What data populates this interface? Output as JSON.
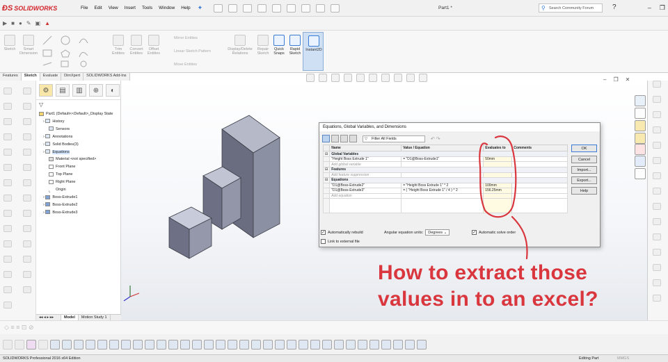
{
  "app": {
    "brand": "SOLIDWORKS",
    "document_title": "Part1 *",
    "search_placeholder": "Search Community Forum",
    "menu": [
      "File",
      "Edit",
      "View",
      "Insert",
      "Tools",
      "Window",
      "Help"
    ]
  },
  "command_manager": {
    "sketch": "Sketch",
    "smart_dimension": "Smart Dimension",
    "trim_entities": "Trim Entities",
    "convert_entities": "Convert Entities",
    "offset_entities": "Offset Entities",
    "mirror_entities": "Mirror Entities",
    "linear_sketch_pattern": "Linear Sketch Pattern",
    "move_entities": "Move Entities",
    "display_delete_relations": "Display/Delete Relations",
    "repair_sketch": "Repair Sketch",
    "quick_snaps": "Quick Snaps",
    "rapid_sketch": "Rapid Sketch",
    "instant2d": "Instant2D"
  },
  "tabs": [
    "Features",
    "Sketch",
    "Evaluate",
    "DimXpert",
    "SOLIDWORKS Add-Ins"
  ],
  "active_tab": "Sketch",
  "feature_tree": {
    "root": "Part1  (Default<<Default>_Display State",
    "items": [
      "History",
      "Sensors",
      "Annotations",
      "Solid Bodies(3)",
      "Equations",
      "Material <not specified>",
      "Front Plane",
      "Top Plane",
      "Right Plane",
      "Origin",
      "Boss-Extrude1",
      "Boss-Extrude2",
      "Boss-Extrude3"
    ],
    "selected": "Equations"
  },
  "bottom_tabs": [
    "Model",
    "Motion Study 1"
  ],
  "dialog": {
    "title": "Equations, Global Variables, and Dimensions",
    "filter": "Filter All Fields",
    "columns": [
      "Name",
      "Value / Equation",
      "Evaluates to",
      "Comments"
    ],
    "sections": {
      "global": "Global Variables",
      "features": "Features",
      "equations": "Equations"
    },
    "rows": {
      "global_var": {
        "name": "\"Height Boss Extrude 1\"",
        "value": "= \"D1@Boss-Extrude1\"",
        "eval": "50mm"
      },
      "add_global": "Add global variable",
      "add_feature": "Add feature suppression",
      "eq1": {
        "name": "\"D1@Boss-Extrude2\"",
        "value": "= \"Height Boss Extrude 1\" * 2",
        "eval": "100mm"
      },
      "eq2": {
        "name": "\"D1@Boss-Extrude3\"",
        "value": "= ( \"Height Boss Extrude 1\" / 4 ) ^ 2",
        "eval": "156.25mm"
      },
      "add_equation": "Add equation"
    },
    "buttons": {
      "ok": "OK",
      "cancel": "Cancel",
      "import": "Import...",
      "export": "Export...",
      "help": "Help"
    },
    "auto_rebuild": "Automatically rebuild",
    "angular_units_label": "Angular equation units:",
    "angular_units_value": "Degrees",
    "auto_solve": "Automatic solve order",
    "link_external": "Link to external file"
  },
  "annotation": {
    "question_line1": "How to extract those",
    "question_line2": "values in to an excel?",
    "color": "#d9363e"
  },
  "status": {
    "edition": "SOLIDWORKS Professional 2016 x64 Edition",
    "mode": "Editing Part",
    "units": "MMGS"
  }
}
